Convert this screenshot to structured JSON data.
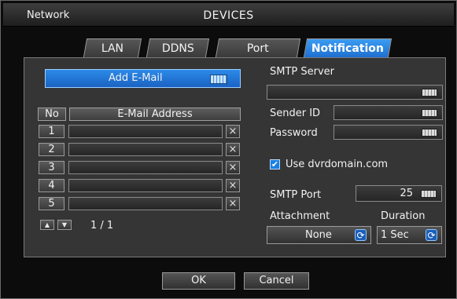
{
  "window": {
    "section": "Network",
    "title": "DEVICES"
  },
  "tabs": [
    {
      "label": "LAN"
    },
    {
      "label": "DDNS"
    },
    {
      "label": "Port"
    },
    {
      "label": "Notification",
      "active": true
    }
  ],
  "email": {
    "add_button_label": "Add E-Mail",
    "table_headers": {
      "no": "No",
      "address": "E-Mail Address"
    },
    "rows": [
      {
        "no": "1",
        "address": ""
      },
      {
        "no": "2",
        "address": ""
      },
      {
        "no": "3",
        "address": ""
      },
      {
        "no": "4",
        "address": ""
      },
      {
        "no": "5",
        "address": ""
      }
    ],
    "delete_glyph": "×",
    "page_indicator": "1 / 1"
  },
  "smtp": {
    "server_label": "SMTP Server",
    "server_value": "",
    "sender_id_label": "Sender ID",
    "sender_id_value": "",
    "password_label": "Password",
    "password_value": "",
    "use_dvrdomain_label": "Use dvrdomain.com",
    "use_dvrdomain_checked": true,
    "port_label": "SMTP Port",
    "port_value": "25",
    "attachment_label": "Attachment",
    "attachment_value": "None",
    "duration_label": "Duration",
    "duration_value": "1 Sec"
  },
  "footer": {
    "ok_label": "OK",
    "cancel_label": "Cancel"
  },
  "icons": {
    "keyboard": "keyboard-icon",
    "refresh": "refresh-icon",
    "delete": "close-icon",
    "page_up": "arrow-up-icon",
    "page_down": "arrow-down-icon",
    "check": "checkmark-icon"
  },
  "colors": {
    "accent": "#2c8ae8",
    "panel": "#353535",
    "background": "#0c0c0c"
  }
}
